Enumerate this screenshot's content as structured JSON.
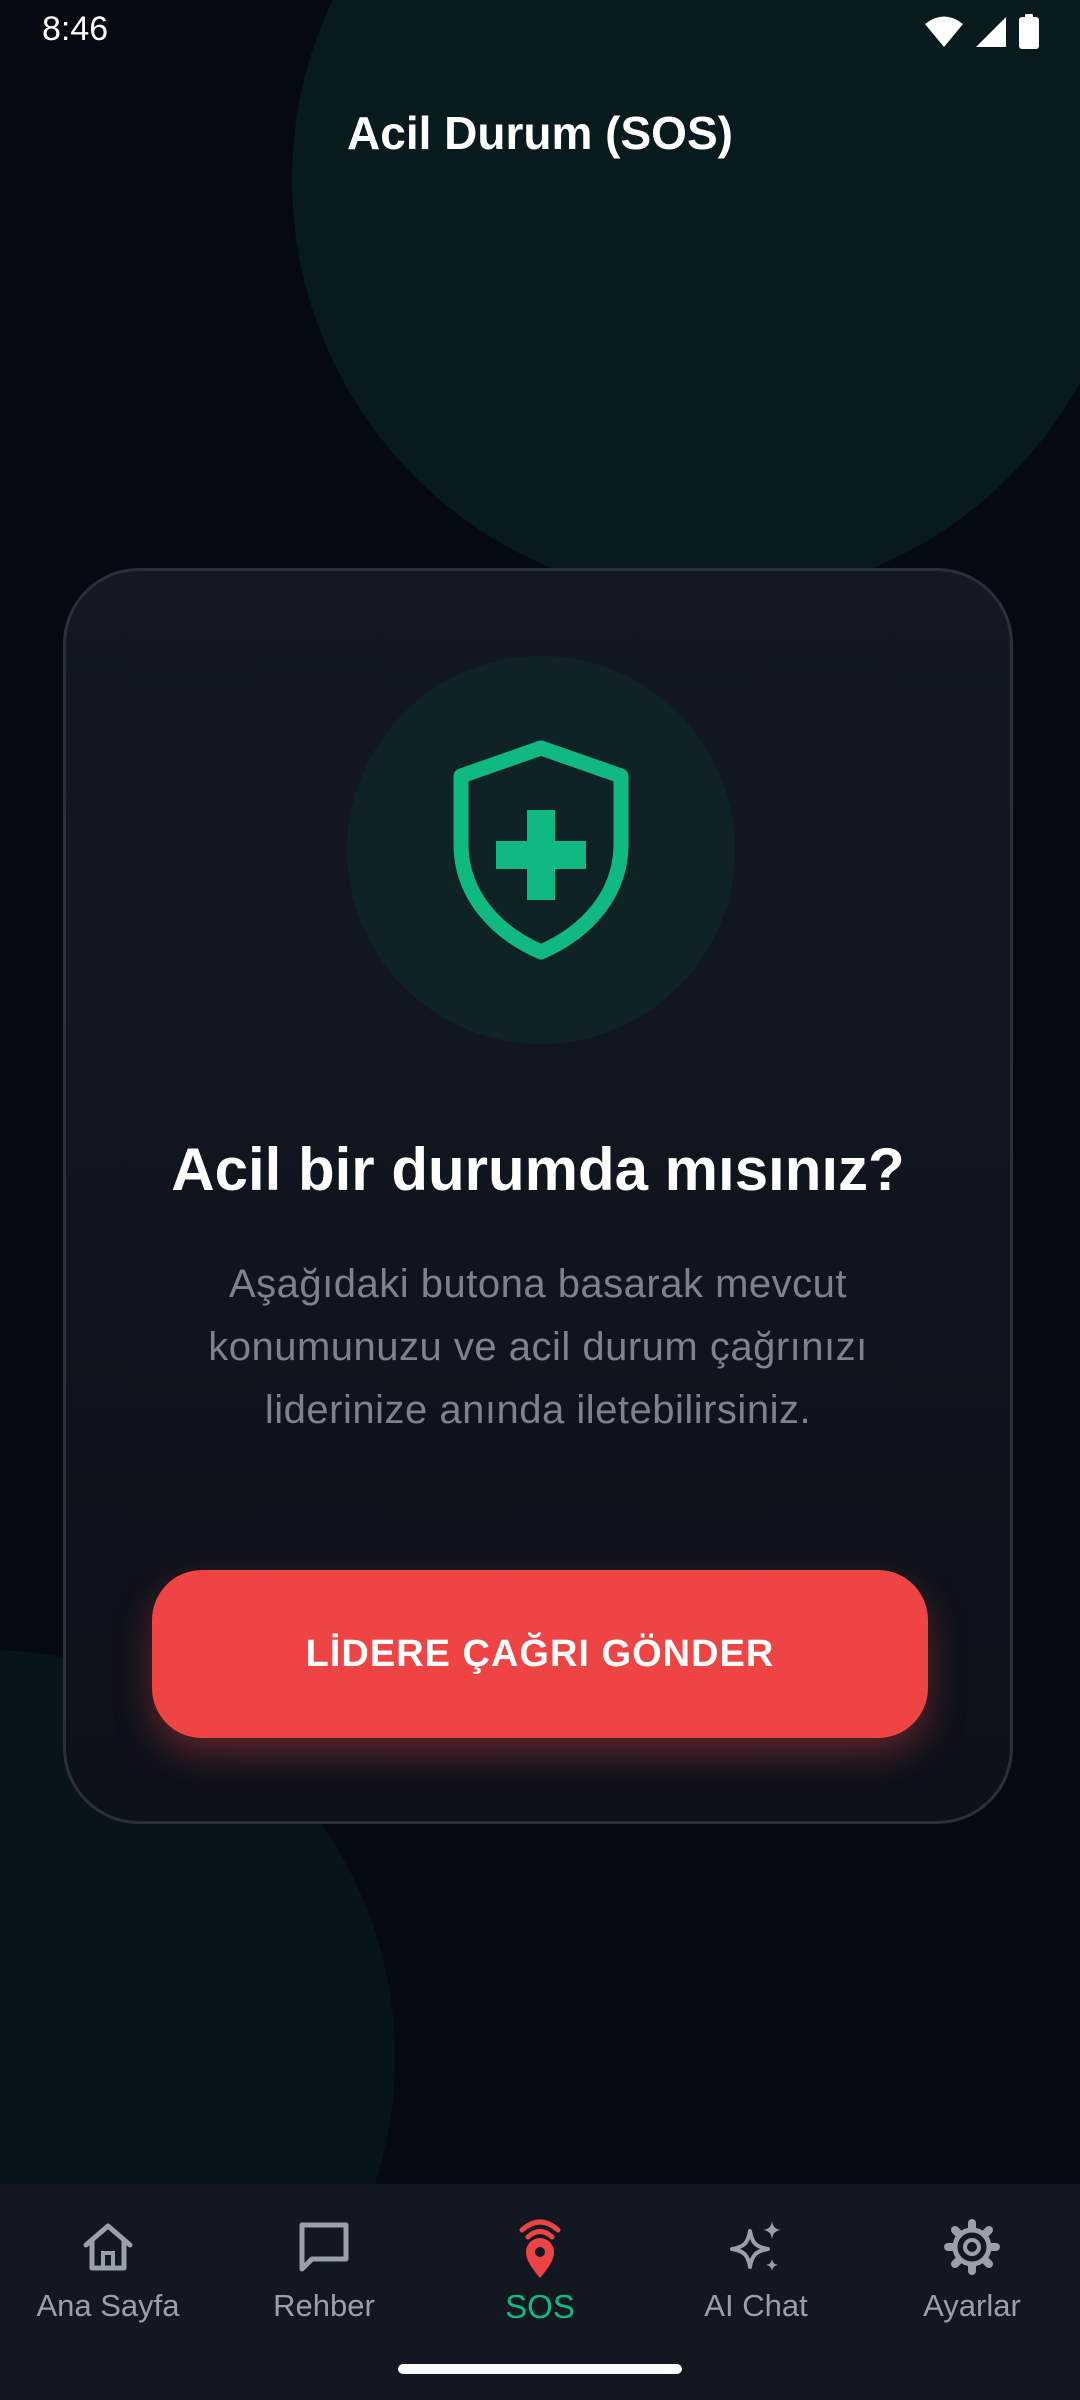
{
  "status_bar": {
    "time": "8:46",
    "icons": [
      "wifi-icon",
      "signal-icon",
      "battery-icon"
    ]
  },
  "header": {
    "title": "Acil Durum (SOS)"
  },
  "card": {
    "icon": "shield-plus-icon",
    "heading": "Acil bir durumda mısınız?",
    "description": "Aşağıdaki butona basarak mevcut konumunuzu ve acil durum çağrınızı liderinize anında iletebilirsiniz.",
    "button_label": "LİDERE ÇAĞRI GÖNDER"
  },
  "bottom_nav": {
    "items": [
      {
        "label": "Ana Sayfa",
        "icon": "home-icon",
        "active": false
      },
      {
        "label": "Rehber",
        "icon": "chat-bubble-icon",
        "active": false
      },
      {
        "label": "SOS",
        "icon": "sos-location-icon",
        "active": true
      },
      {
        "label": "AI Chat",
        "icon": "sparkles-icon",
        "active": false
      },
      {
        "label": "Ayarlar",
        "icon": "gear-icon",
        "active": false
      }
    ]
  },
  "colors": {
    "background": "#050a12",
    "accent_green": "#10b981",
    "sos_red": "#ef4444",
    "card_bg": "#111621",
    "muted_text": "#7d828c"
  }
}
